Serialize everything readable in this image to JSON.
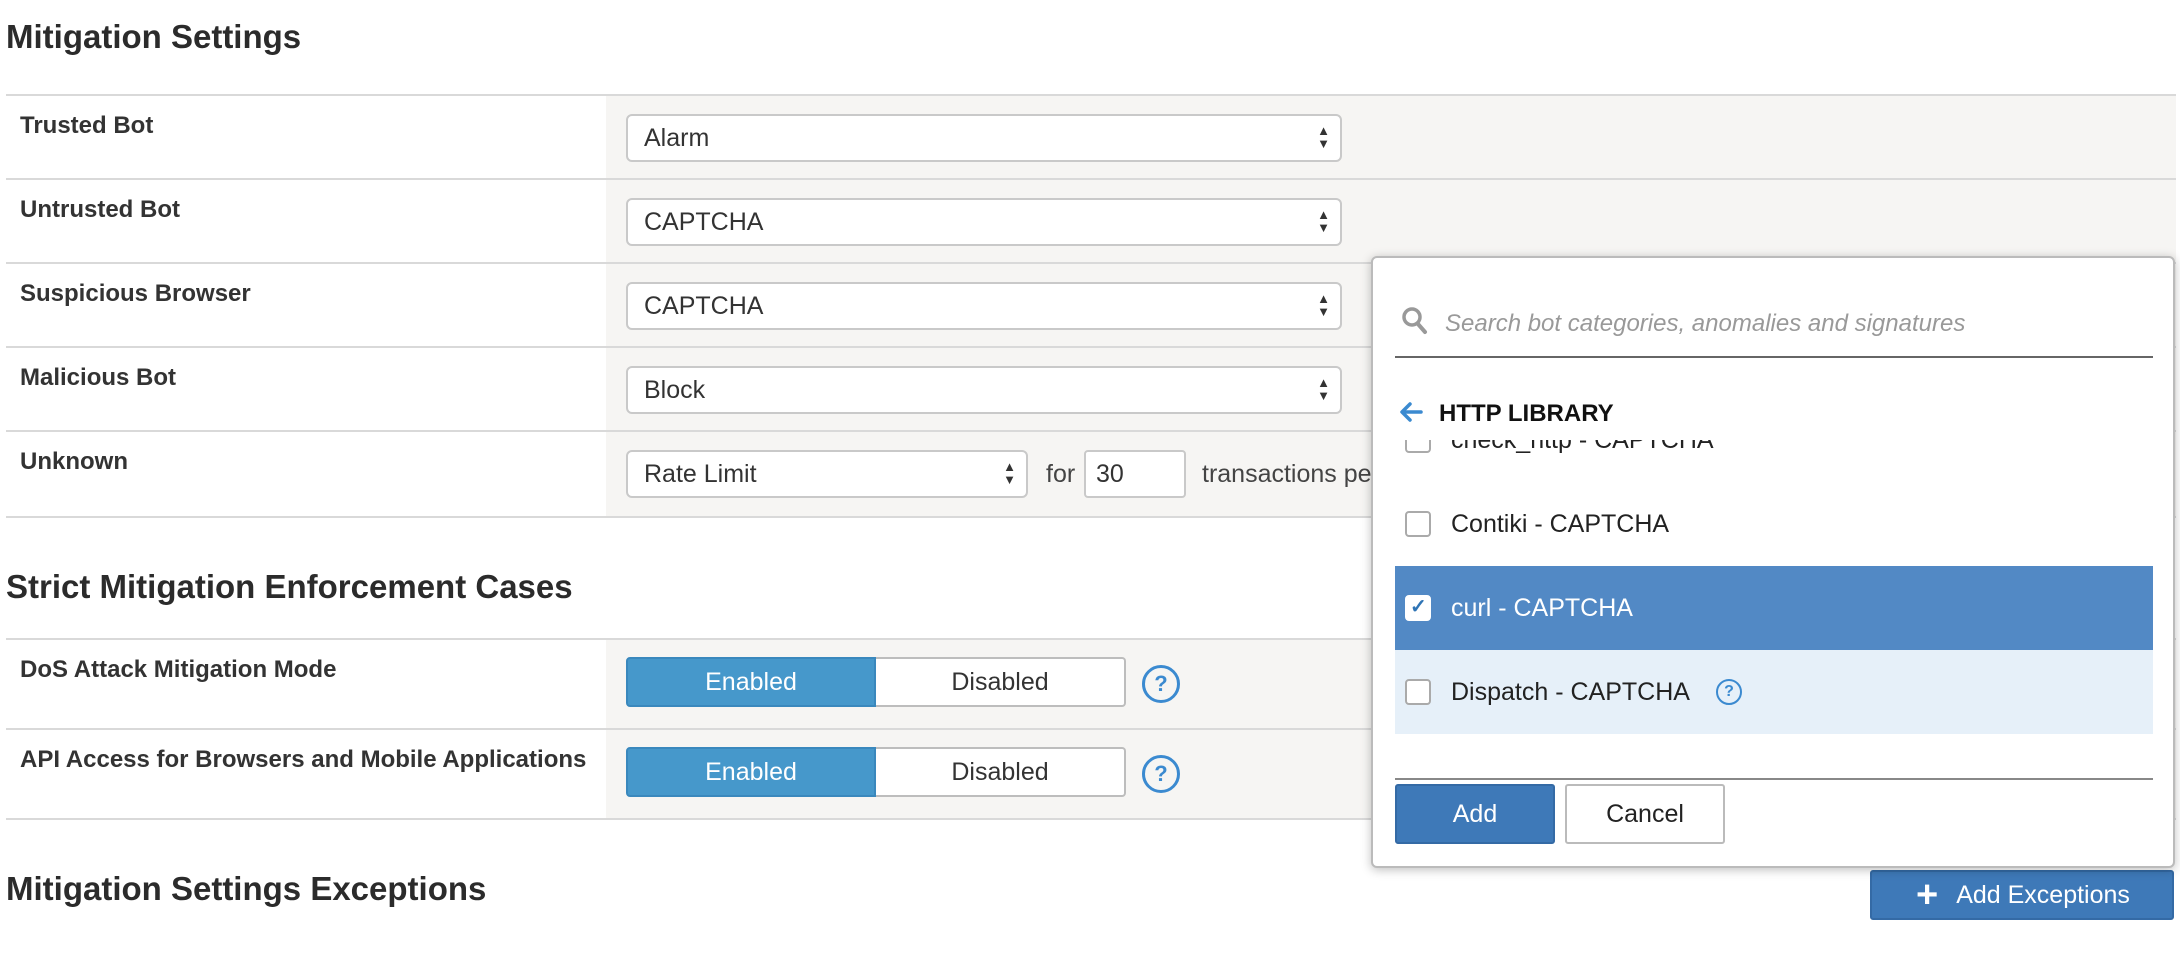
{
  "sections": {
    "mitigation_title": "Mitigation Settings",
    "strict_title": "Strict Mitigation Enforcement Cases",
    "exceptions_title": "Mitigation Settings Exceptions"
  },
  "mitigation_rows": [
    {
      "label": "Trusted Bot",
      "value": "Alarm"
    },
    {
      "label": "Untrusted Bot",
      "value": "CAPTCHA"
    },
    {
      "label": "Suspicious Browser",
      "value": "CAPTCHA"
    },
    {
      "label": "Malicious Bot",
      "value": "Block"
    },
    {
      "label": "Unknown",
      "value": "Rate Limit",
      "for_text": "for",
      "rate_value": "30",
      "rate_suffix": "transactions per"
    }
  ],
  "strict_rows": [
    {
      "label": "DoS Attack Mitigation Mode",
      "enabled": "Enabled",
      "disabled": "Disabled",
      "selected": "Enabled"
    },
    {
      "label": "API Access for Browsers and Mobile Applications",
      "enabled": "Enabled",
      "disabled": "Disabled",
      "selected": "Enabled"
    }
  ],
  "popup": {
    "search_placeholder": "Search bot categories, anomalies and signatures",
    "breadcrumb": "HTTP LIBRARY",
    "items": [
      {
        "label": "check_http - CAPTCHA",
        "checked": false
      },
      {
        "label": "Contiki - CAPTCHA",
        "checked": false
      },
      {
        "label": "curl - CAPTCHA",
        "checked": true
      },
      {
        "label": "Dispatch - CAPTCHA",
        "checked": false
      }
    ],
    "add_label": "Add",
    "cancel_label": "Cancel"
  },
  "add_exceptions_label": "Add Exceptions",
  "help_glyph": "?",
  "colors": {
    "accent": "#4698cb",
    "primary_button": "#3e79b8",
    "selected_row": "#5289c5",
    "hover_row": "#e6f0f9",
    "value_cell_bg": "#f6f5f3"
  }
}
